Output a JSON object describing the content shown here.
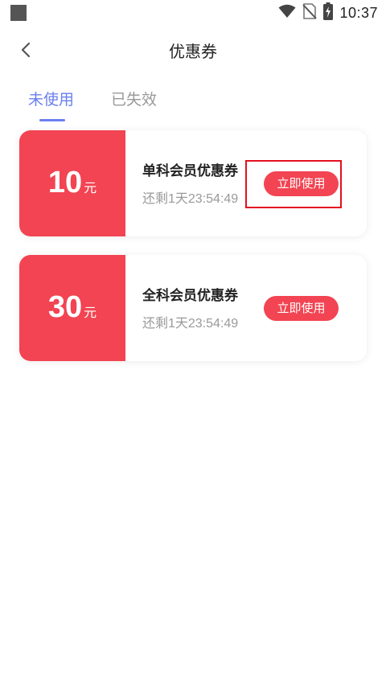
{
  "status_bar": {
    "time": "10:37",
    "icons": [
      "notification-square-icon",
      "wifi-icon",
      "no-sim-icon",
      "battery-charging-icon"
    ]
  },
  "header": {
    "back_icon": "chevron-left-icon",
    "title": "优惠券"
  },
  "tabs": [
    {
      "label": "未使用",
      "active": true
    },
    {
      "label": "已失效",
      "active": false
    }
  ],
  "colors": {
    "accent": "#6a7ff0",
    "coupon_red": "#f24452",
    "text_dark": "#222222",
    "text_gray": "#9a9a9a",
    "highlight_border": "#e30f1f"
  },
  "coupons": [
    {
      "amount": "10",
      "unit": "元",
      "name": "单科会员优惠券",
      "remaining": "还剩1天23:54:49",
      "button_label": "立即使用"
    },
    {
      "amount": "30",
      "unit": "元",
      "name": "全科会员优惠券",
      "remaining": "还剩1天23:54:49",
      "button_label": "立即使用"
    }
  ]
}
